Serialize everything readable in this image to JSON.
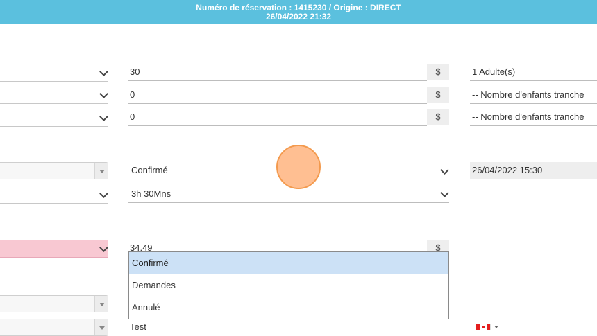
{
  "header": {
    "line1": "Numéro de réservation : 1415230 / Origine : DIRECT",
    "line2": "26/04/2022 21:32"
  },
  "rows": [
    {
      "amount": "30",
      "currency": "$",
      "guests": "1 Adulte(s)"
    },
    {
      "amount": "0",
      "currency": "$",
      "guests": "-- Nombre d'enfants tranche"
    },
    {
      "amount": "0",
      "currency": "$",
      "guests": "-- Nombre d'enfants tranche"
    }
  ],
  "status": {
    "value": "Confirmé",
    "date": "26/04/2022 15:30",
    "options": [
      "Confirmé",
      "Demandes",
      "Annulé"
    ]
  },
  "duration": {
    "value": "3h 30Mns"
  },
  "price": {
    "value": "34.49",
    "currency": "$"
  },
  "name": {
    "value": "Test"
  },
  "colors": {
    "header_bg": "#5bc0de",
    "pink_select": "#f8c8d2",
    "active_option": "#cce1f6",
    "status_underline": "#f0c040",
    "click_marker": "#f39a4e"
  }
}
